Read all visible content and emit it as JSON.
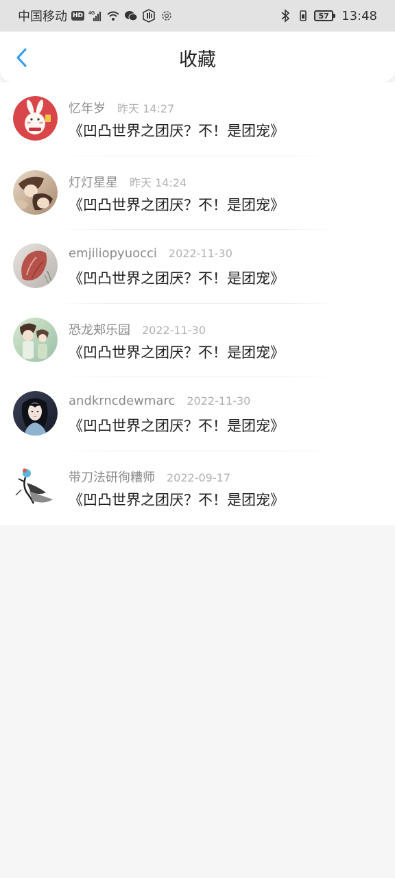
{
  "status_bar": {
    "carrier": "中国移动",
    "hd_badge": "HD",
    "network": "4G",
    "battery": "57",
    "time": "13:48",
    "icons": [
      "hd-icon",
      "signal-icon",
      "wifi-icon",
      "wechat-icon",
      "hand-icon",
      "gear-icon",
      "bluetooth-icon",
      "vibrate-icon",
      "battery-icon"
    ]
  },
  "header": {
    "title": "收藏",
    "back_icon": "chevron-left-icon",
    "accent_color": "#2a9bf3"
  },
  "favorites": [
    {
      "user": "忆年岁",
      "time": "昨天 14:27",
      "title": "《凹凸世界之团厌？不！是团宠》"
    },
    {
      "user": "灯灯星星",
      "time": "昨天 14:24",
      "title": "《凹凸世界之团厌？不！是团宠》"
    },
    {
      "user": "emjiliopyuocci",
      "time": "2022-11-30",
      "title": "《凹凸世界之团厌？不！是团宠》"
    },
    {
      "user": "恐龙郏乐园",
      "time": "2022-11-30",
      "title": "《凹凸世界之团厌？不！是团宠》"
    },
    {
      "user": "andkrncdewmarc",
      "time": "2022-11-30",
      "title": "《凹凸世界之团厌？不！是团宠》"
    },
    {
      "user": "带刀法研徇糟师",
      "time": "2022-09-17",
      "title": "《凹凸世界之团厌？不！是团宠》"
    }
  ]
}
